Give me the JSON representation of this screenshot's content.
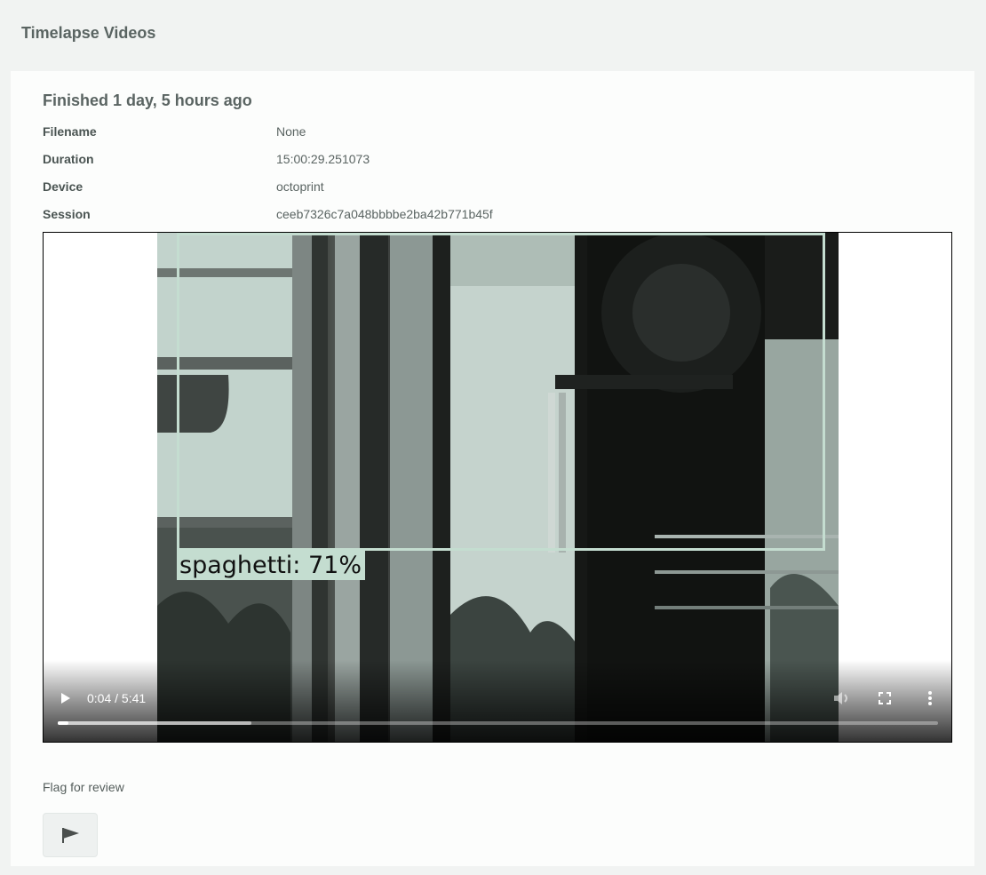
{
  "page": {
    "title": "Timelapse Videos"
  },
  "timelapse": {
    "status": "Finished 1 day, 5 hours ago",
    "details": [
      {
        "label": "Filename",
        "value": "None"
      },
      {
        "label": "Duration",
        "value": "15:00:29.251073"
      },
      {
        "label": "Device",
        "value": "octoprint"
      },
      {
        "label": "Session",
        "value": "ceeb7326c7a048bbbbe2ba42b771b45f"
      }
    ]
  },
  "video": {
    "detection_label": "spaghetti: 71%",
    "time_display": "0:04 / 5:41",
    "played_fraction": 0.0117,
    "buffered_fraction": 0.22,
    "icons": {
      "play": "play-icon",
      "volume": "volume-icon",
      "fullscreen": "fullscreen-icon",
      "more": "more-options-icon"
    }
  },
  "review": {
    "flag_label": "Flag for review",
    "flag_icon": "flag-icon"
  },
  "colors": {
    "detection_box": "#c4ddd0",
    "page_background": "#f1f3f2",
    "card_background": "#fcfdfc"
  }
}
